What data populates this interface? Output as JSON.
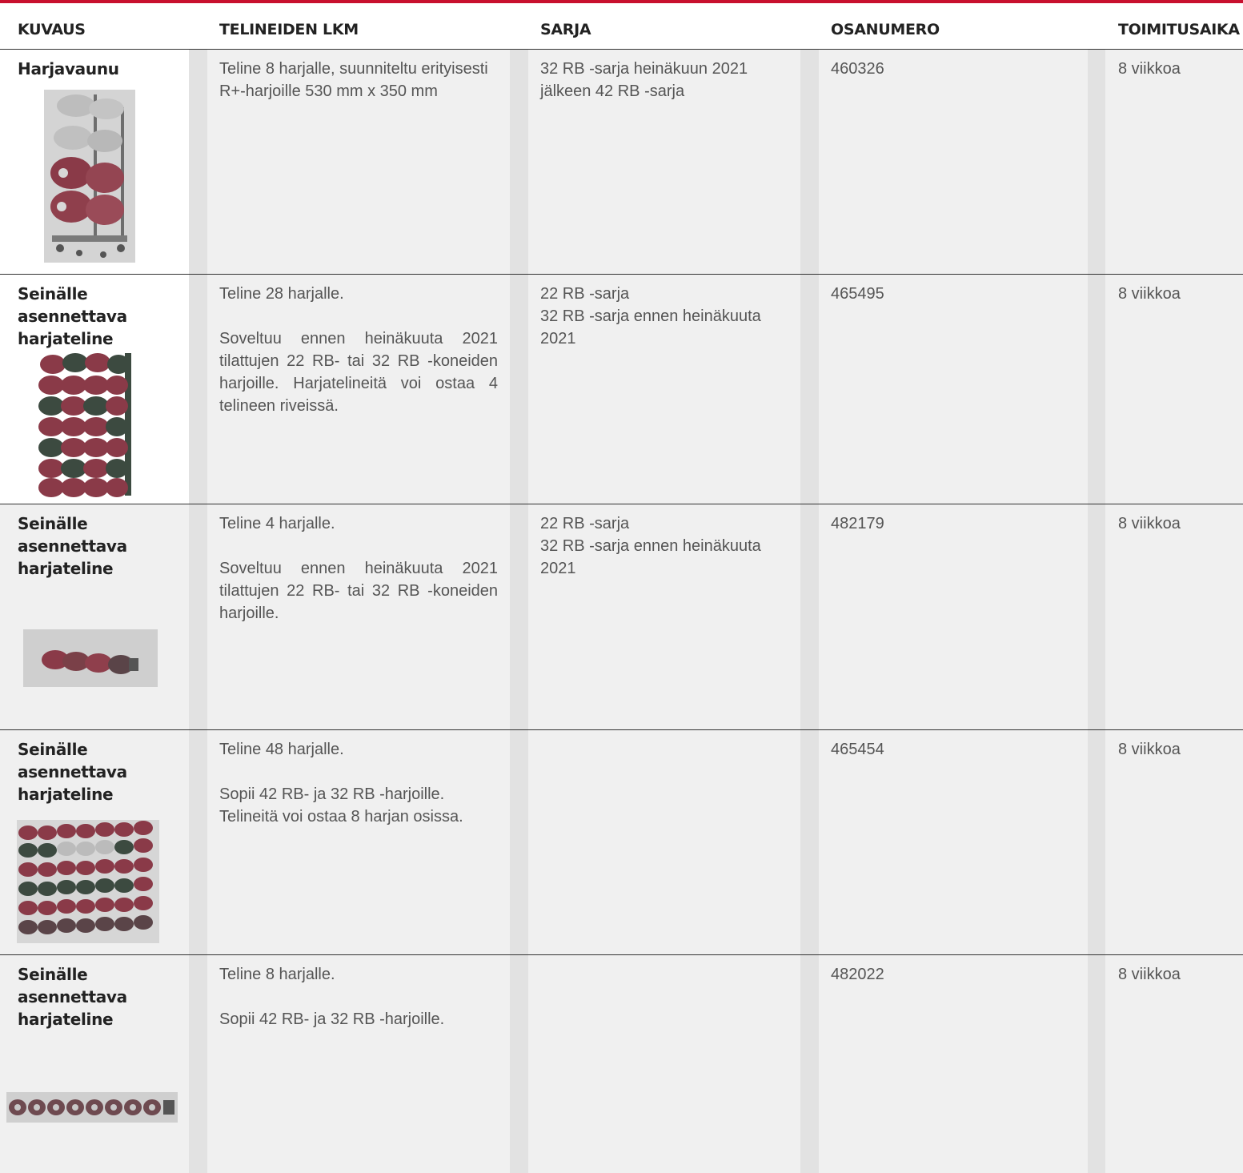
{
  "headers": {
    "kuvaus": "KUVAUS",
    "telineiden_lkm": "TELINEIDEN LKM",
    "sarja": "SARJA",
    "osanumero": "OSANUMERO",
    "toimitusaika": "TOIMITUSAIKA"
  },
  "rows": [
    {
      "title": "Harjavaunu",
      "description": [
        "Teline 8 harjalle, suunniteltu erityisesti R+-harjoille 530 mm x 350 mm"
      ],
      "sarja": [
        "32 RB -sarja heinäkuun 2021 jälkeen 42 RB -sarja"
      ],
      "osanumero": "460326",
      "toimitusaika": "8 viikkoa",
      "image_icon": "brush-cart-image"
    },
    {
      "title": "Seinälle asennettava harjateline",
      "description": [
        "Teline 28 harjalle.",
        "Soveltuu ennen heinäkuuta 2021 tilattujen 22 RB- tai 32 RB -koneiden harjoille. Harjatelineitä voi ostaa 4 telineen riveissä."
      ],
      "sarja": [
        "22 RB -sarja",
        "32 RB -sarja ennen heinäkuuta 2021"
      ],
      "osanumero": "465495",
      "toimitusaika": "8 viikkoa",
      "image_icon": "wall-rack-28-image"
    },
    {
      "title": "Seinälle asennettava harjateline",
      "description": [
        "Teline 4 harjalle.",
        "Soveltuu ennen heinäkuuta 2021 tilattujen 22 RB- tai 32 RB -koneiden harjoille."
      ],
      "sarja": [
        "22 RB -sarja",
        "32 RB -sarja ennen heinäkuuta 2021"
      ],
      "osanumero": "482179",
      "toimitusaika": "8 viikkoa",
      "image_icon": "wall-rack-4-image"
    },
    {
      "title": "Seinälle asennettava harjateline",
      "description": [
        "Teline 48 harjalle.",
        "Sopii 42 RB- ja 32 RB -harjoille. Telineitä voi ostaa 8 harjan osissa."
      ],
      "sarja": [],
      "osanumero": "465454",
      "toimitusaika": "8 viikkoa",
      "image_icon": "wall-rack-48-image"
    },
    {
      "title": "Seinälle asennettava harjateline",
      "description": [
        "Teline 8 harjalle.",
        "Sopii 42 RB- ja 32 RB -harjoille."
      ],
      "sarja": [],
      "osanumero": "482022",
      "toimitusaika": "8 viikkoa",
      "image_icon": "wall-rack-8-image"
    }
  ],
  "colors": {
    "accent": "#c8102e",
    "column_light": "#f0f0f0",
    "column_dark": "#e2e2e2",
    "brush_red": "#8a3a48",
    "brush_green": "#3c4a40"
  }
}
